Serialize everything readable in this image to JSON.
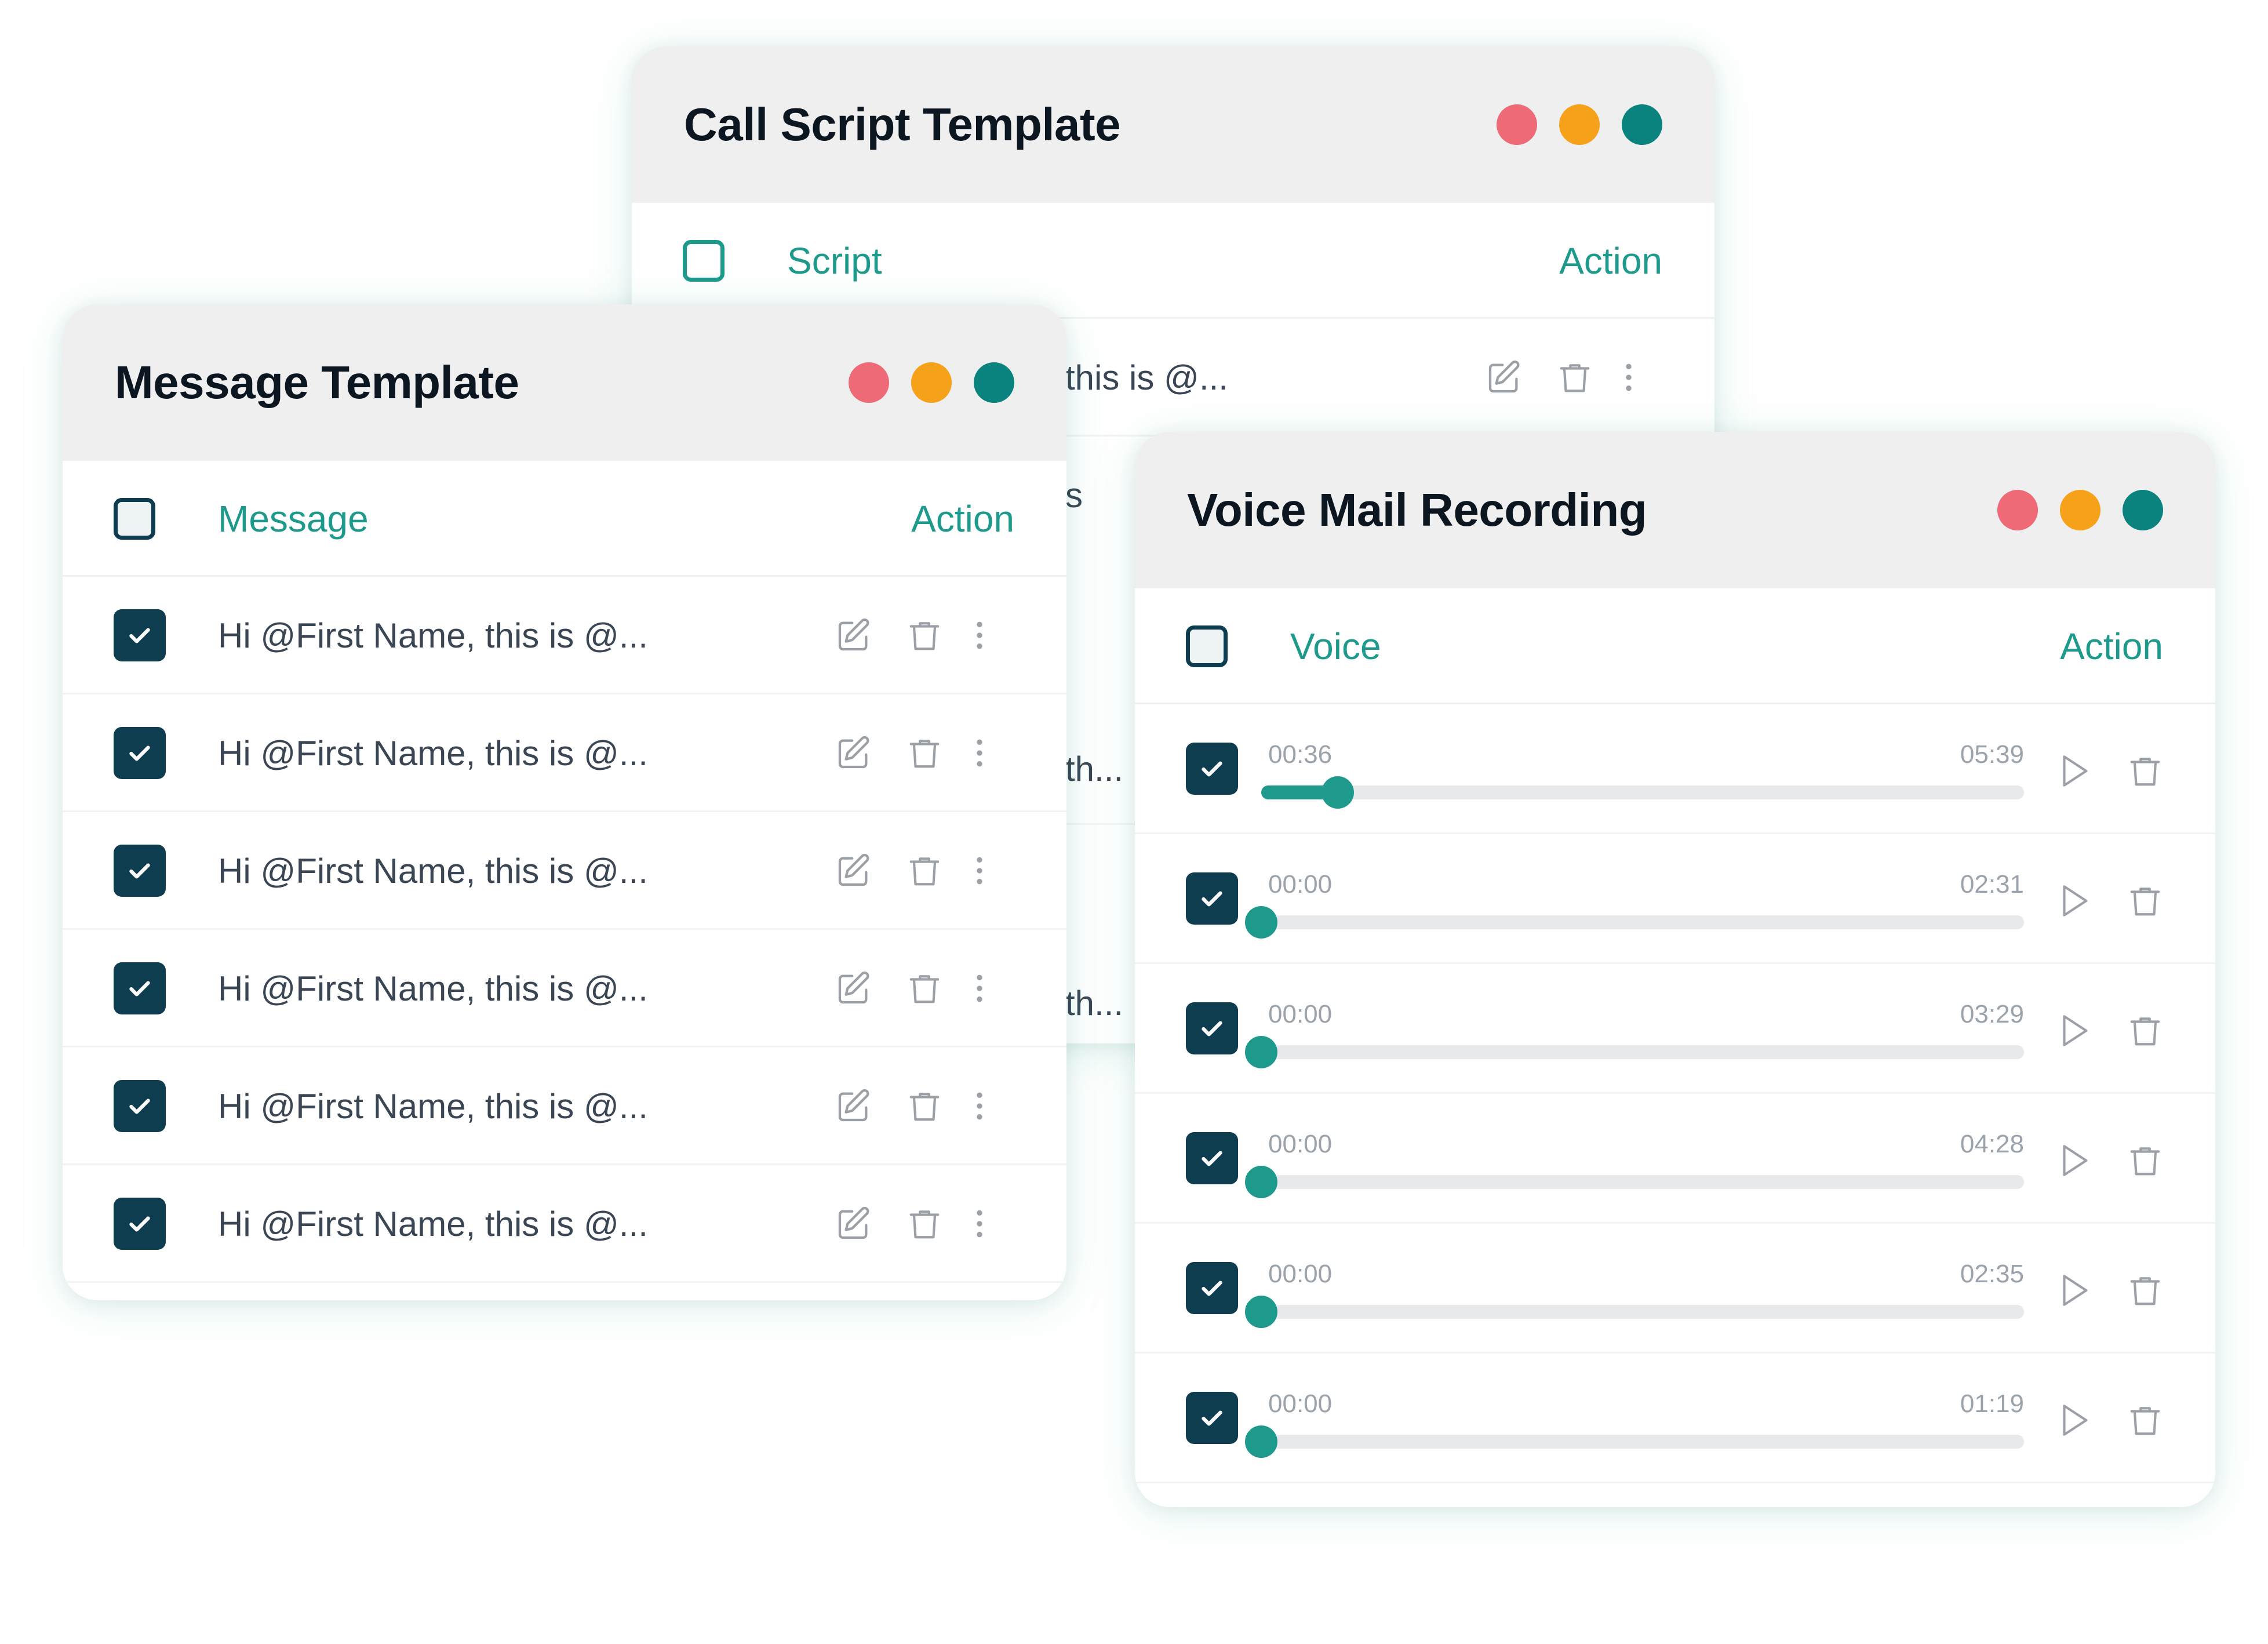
{
  "colors": {
    "accent": "#1e9a8c",
    "checkbox": "#0e3d4f",
    "dot_red": "#ee6a77",
    "dot_orange": "#f5a11a",
    "dot_teal": "#0a837f"
  },
  "call_script": {
    "title": "Call Script Template",
    "col_script": "Script",
    "col_action": "Action",
    "row1_text": "this is @...",
    "peek_s": "s",
    "peek_th1": "th...",
    "peek_th2": "th..."
  },
  "message_template": {
    "title": "Message Template",
    "col_message": "Message",
    "col_action": "Action",
    "rows": [
      {
        "text": "Hi @First Name, this is @...",
        "checked": true
      },
      {
        "text": "Hi @First Name, this is @...",
        "checked": true
      },
      {
        "text": "Hi @First Name, this is @...",
        "checked": true
      },
      {
        "text": "Hi @First Name, this is @...",
        "checked": true
      },
      {
        "text": "Hi @First Name, this is @...",
        "checked": true
      },
      {
        "text": "Hi @First Name, this is @...",
        "checked": true
      }
    ]
  },
  "voice_mail": {
    "title": "Voice Mail Recording",
    "col_voice": "Voice",
    "col_action": "Action",
    "rows": [
      {
        "current": "00:36",
        "duration": "05:39",
        "progress": 0.1,
        "checked": true
      },
      {
        "current": "00:00",
        "duration": "02:31",
        "progress": 0,
        "checked": true
      },
      {
        "current": "00:00",
        "duration": "03:29",
        "progress": 0,
        "checked": true
      },
      {
        "current": "00:00",
        "duration": "04:28",
        "progress": 0,
        "checked": true
      },
      {
        "current": "00:00",
        "duration": "02:35",
        "progress": 0,
        "checked": true
      },
      {
        "current": "00:00",
        "duration": "01:19",
        "progress": 0,
        "checked": true
      }
    ]
  }
}
